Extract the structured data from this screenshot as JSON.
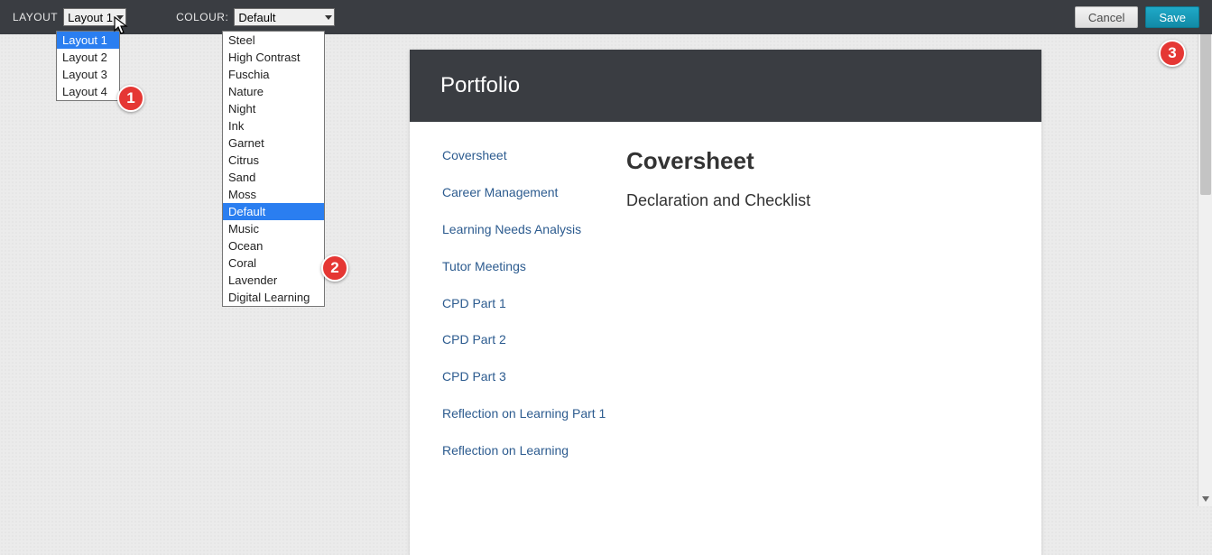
{
  "toolbar": {
    "layout_label": "LAYOUT",
    "layout_selected": "Layout 1",
    "layout_options": [
      "Layout 1",
      "Layout 2",
      "Layout 3",
      "Layout 4"
    ],
    "colour_label": "COLOUR:",
    "colour_selected": "Default",
    "colour_options": [
      "Steel",
      "High Contrast",
      "Fuschia",
      "Nature",
      "Night",
      "Ink",
      "Garnet",
      "Citrus",
      "Sand",
      "Moss",
      "Default",
      "Music",
      "Ocean",
      "Coral",
      "Lavender",
      "Digital Learning"
    ],
    "cancel_label": "Cancel",
    "save_label": "Save"
  },
  "annotations": {
    "b1": "1",
    "b2": "2",
    "b3": "3"
  },
  "page": {
    "title": "Portfolio",
    "nav": [
      "Coversheet",
      "Career Management",
      "Learning Needs Analysis",
      "Tutor Meetings",
      "CPD Part 1",
      "CPD Part 2",
      "CPD Part 3",
      "Reflection on Learning Part 1",
      "Reflection on Learning"
    ],
    "content": {
      "heading": "Coversheet",
      "subheading": "Declaration and Checklist"
    }
  }
}
